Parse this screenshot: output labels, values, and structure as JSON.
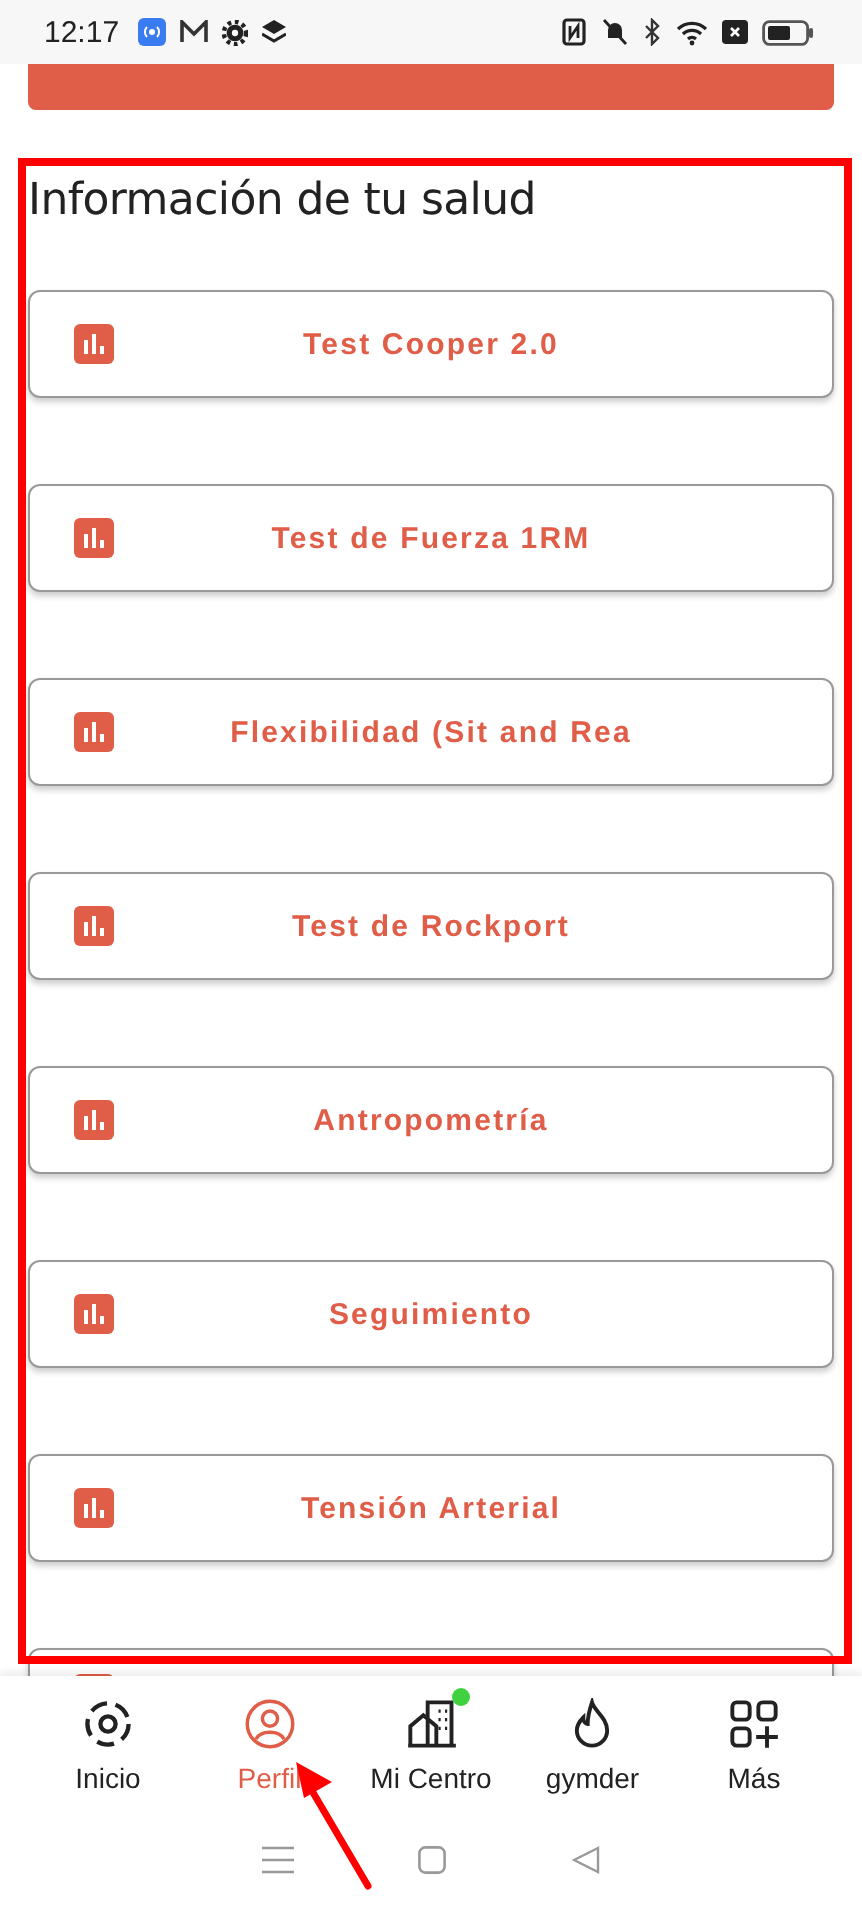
{
  "status_bar": {
    "time": "12:17"
  },
  "heading": "Información de tu salud",
  "tests": [
    {
      "kind": "full",
      "title": "Test Cooper 2.0"
    },
    {
      "kind": "full",
      "title": "Test de Fuerza 1RM"
    },
    {
      "kind": "full",
      "title": "Flexibilidad (Sit and Rea"
    },
    {
      "kind": "full",
      "title": "Test de Rockport"
    },
    {
      "kind": "full",
      "title": "Antropometría"
    },
    {
      "kind": "full",
      "title": "Seguimiento"
    },
    {
      "kind": "full",
      "title": "Tensión Arterial"
    },
    {
      "kind": "cut"
    }
  ],
  "nav": [
    {
      "kind": "home",
      "label": "Inicio",
      "selected": false,
      "badge": false
    },
    {
      "kind": "profile",
      "label": "Perfil",
      "selected": true,
      "badge": false
    },
    {
      "kind": "building",
      "label": "Mi Centro",
      "selected": false,
      "badge": true
    },
    {
      "kind": "flame",
      "label": "gymder",
      "selected": false,
      "badge": false
    },
    {
      "kind": "grid",
      "label": "Más",
      "selected": false,
      "badge": false
    }
  ]
}
